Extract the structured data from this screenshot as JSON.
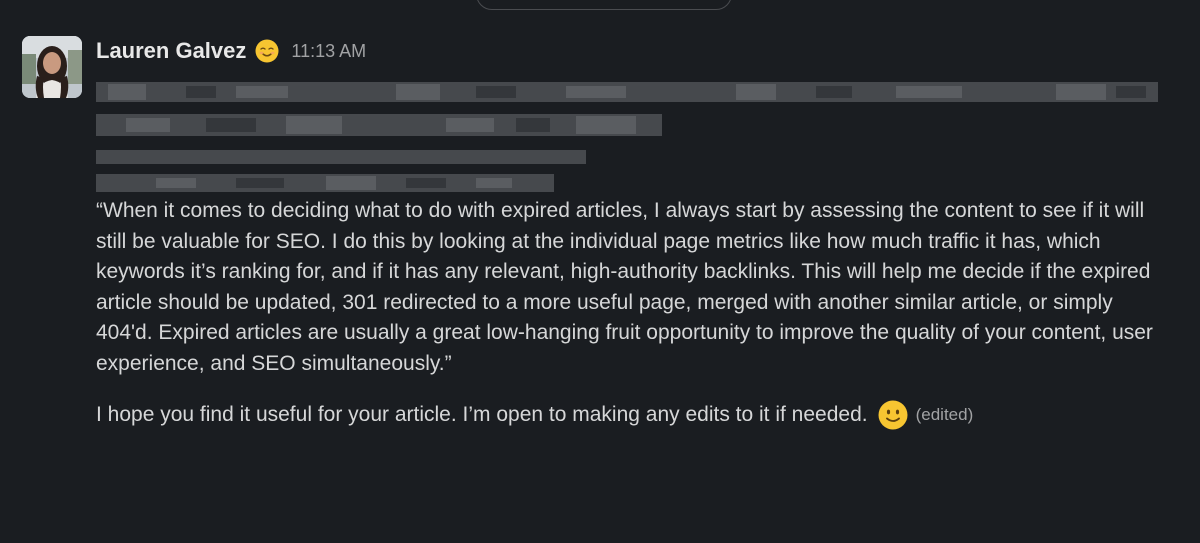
{
  "message": {
    "author": "Lauren Galvez",
    "status_emoji": "relieved-face-emoji",
    "timestamp": "11:13 AM",
    "quote": "“When it comes to deciding what to do with expired articles, I always start by assessing the content to see if it will still be valuable for SEO. I do this by looking at the individual page metrics like how much traffic it has, which keywords it’s ranking for, and if it has any relevant, high-authority backlinks. This will help me decide if the expired article should be updated, 301 redirected to a more useful page, merged with another similar article, or simply 404'd. Expired articles are usually a great low-hanging fruit opportunity to improve the quality of your content, user experience, and SEO simultaneously.”",
    "closing": "I hope you find it useful for your article. I’m open to making any edits to it if needed.",
    "closing_emoji": "slightly-smiling-face-emoji",
    "edited_label": "(edited)"
  },
  "colors": {
    "background": "#1a1d21",
    "text": "#d6d7d8",
    "muted": "#a1a2a4",
    "emoji_yellow": "#f7c531"
  }
}
